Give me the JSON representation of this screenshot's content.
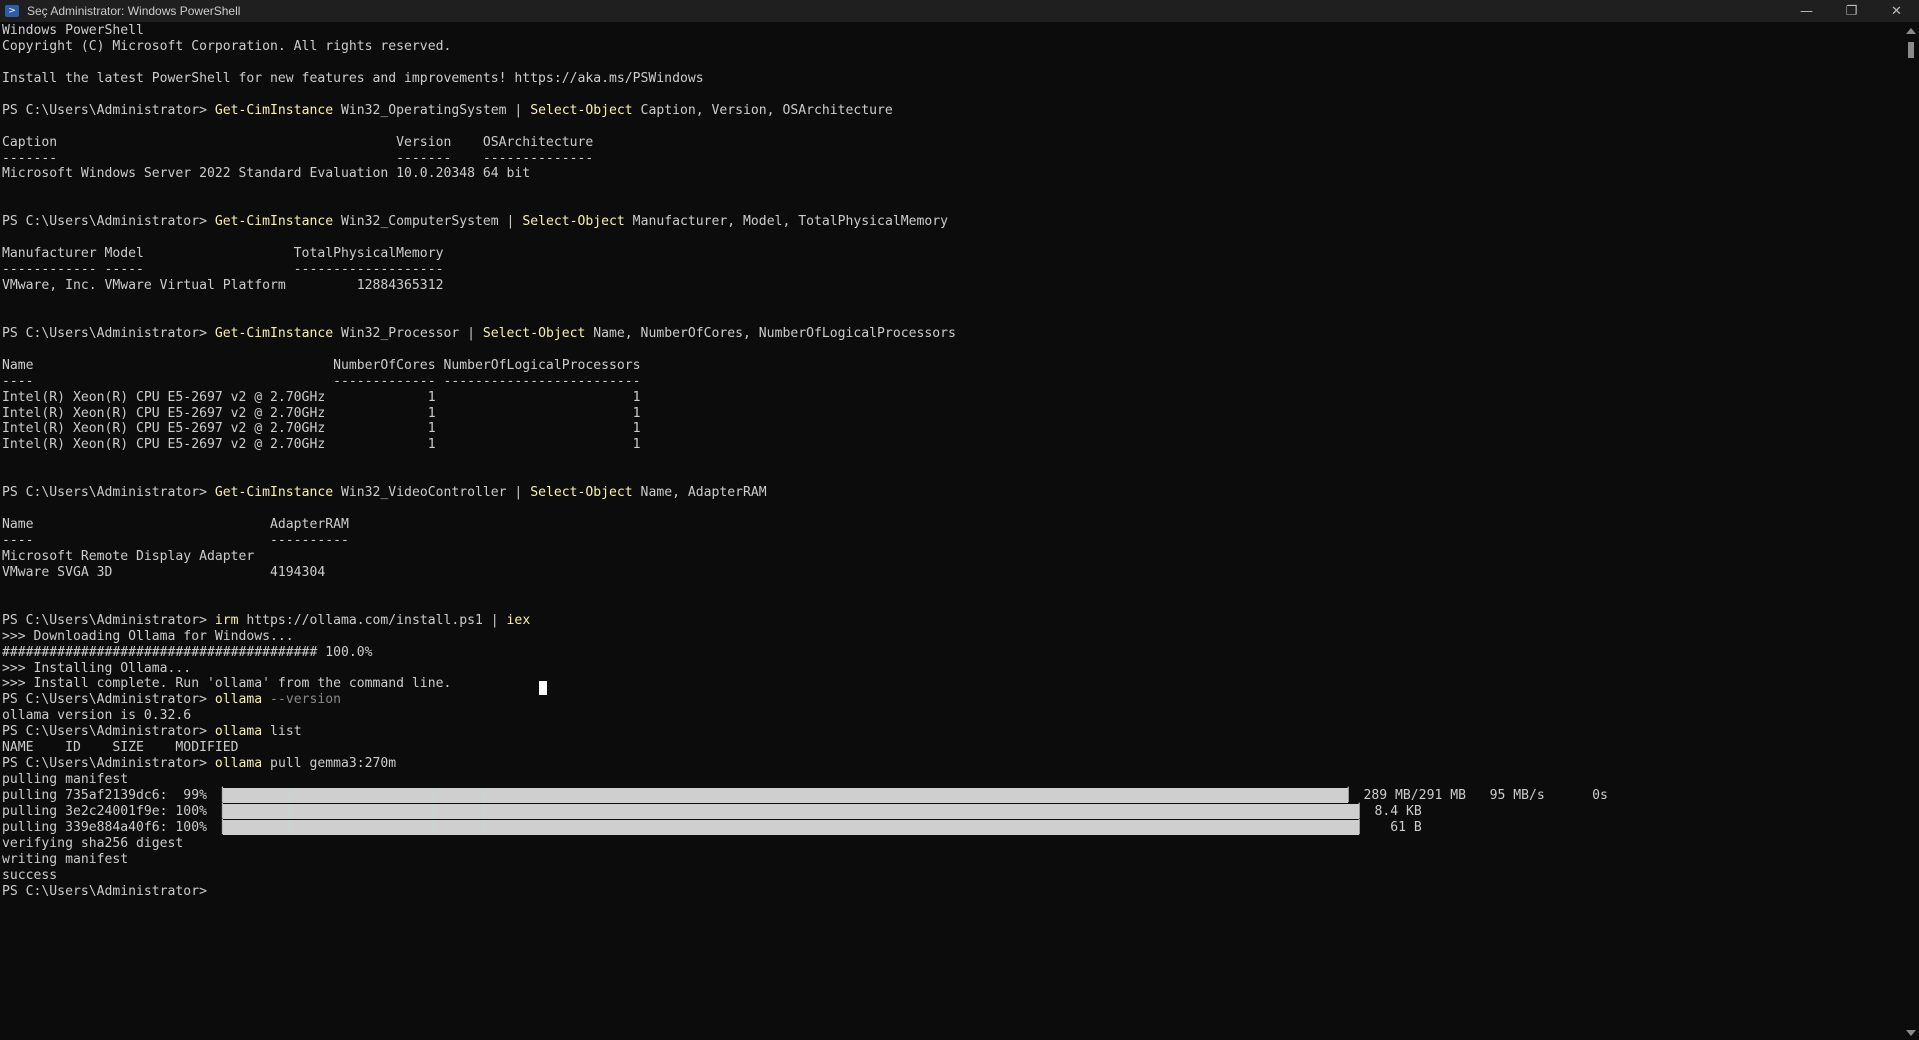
{
  "window": {
    "title": "Seç Administrator: Windows PowerShell",
    "icon": "powershell-icon",
    "controls": {
      "minimize": "—",
      "restore": "❐",
      "close": "✕"
    }
  },
  "console": {
    "prompt": "PS C:\\Users\\Administrator>",
    "lines": [
      [
        {
          "t": "Windows PowerShell"
        }
      ],
      [
        {
          "t": "Copyright (C) Microsoft Corporation. All rights reserved."
        }
      ],
      [
        {
          "t": ""
        }
      ],
      [
        {
          "t": "Install the latest PowerShell for new features and improvements! https://aka.ms/PSWindows"
        }
      ],
      [
        {
          "t": ""
        }
      ],
      [
        {
          "t": "PS C:\\Users\\Administrator> "
        },
        {
          "t": "Get-CimInstance",
          "c": "cmd"
        },
        {
          "t": " Win32_OperatingSystem | "
        },
        {
          "t": "Select-Object",
          "c": "cmd"
        },
        {
          "t": " Caption, Version, OSArchitecture"
        }
      ],
      [
        {
          "t": ""
        }
      ],
      [
        {
          "t": "Caption                                           Version    OSArchitecture"
        }
      ],
      [
        {
          "t": "-------                                           -------    --------------"
        }
      ],
      [
        {
          "t": "Microsoft Windows Server 2022 Standard Evaluation 10.0.20348 64 bit"
        }
      ],
      [
        {
          "t": ""
        }
      ],
      [
        {
          "t": ""
        }
      ],
      [
        {
          "t": "PS C:\\Users\\Administrator> "
        },
        {
          "t": "Get-CimInstance",
          "c": "cmd"
        },
        {
          "t": " Win32_ComputerSystem | "
        },
        {
          "t": "Select-Object",
          "c": "cmd"
        },
        {
          "t": " Manufacturer, Model, TotalPhysicalMemory"
        }
      ],
      [
        {
          "t": ""
        }
      ],
      [
        {
          "t": "Manufacturer Model                   TotalPhysicalMemory"
        }
      ],
      [
        {
          "t": "------------ -----                   -------------------"
        }
      ],
      [
        {
          "t": "VMware, Inc. VMware Virtual Platform         12884365312"
        }
      ],
      [
        {
          "t": ""
        }
      ],
      [
        {
          "t": ""
        }
      ],
      [
        {
          "t": "PS C:\\Users\\Administrator> "
        },
        {
          "t": "Get-CimInstance",
          "c": "cmd"
        },
        {
          "t": " Win32_Processor | "
        },
        {
          "t": "Select-Object",
          "c": "cmd"
        },
        {
          "t": " Name, NumberOfCores, NumberOfLogicalProcessors"
        }
      ],
      [
        {
          "t": ""
        }
      ],
      [
        {
          "t": "Name                                      NumberOfCores NumberOfLogicalProcessors"
        }
      ],
      [
        {
          "t": "----                                      ------------- -------------------------"
        }
      ],
      [
        {
          "t": "Intel(R) Xeon(R) CPU E5-2697 v2 @ 2.70GHz             1                         1"
        }
      ],
      [
        {
          "t": "Intel(R) Xeon(R) CPU E5-2697 v2 @ 2.70GHz             1                         1"
        }
      ],
      [
        {
          "t": "Intel(R) Xeon(R) CPU E5-2697 v2 @ 2.70GHz             1                         1"
        }
      ],
      [
        {
          "t": "Intel(R) Xeon(R) CPU E5-2697 v2 @ 2.70GHz             1                         1"
        }
      ],
      [
        {
          "t": ""
        }
      ],
      [
        {
          "t": ""
        }
      ],
      [
        {
          "t": "PS C:\\Users\\Administrator> "
        },
        {
          "t": "Get-CimInstance",
          "c": "cmd"
        },
        {
          "t": " Win32_VideoController | "
        },
        {
          "t": "Select-Object",
          "c": "cmd"
        },
        {
          "t": " Name, AdapterRAM"
        }
      ],
      [
        {
          "t": ""
        }
      ],
      [
        {
          "t": "Name                              AdapterRAM"
        }
      ],
      [
        {
          "t": "----                              ----------"
        }
      ],
      [
        {
          "t": "Microsoft Remote Display Adapter"
        }
      ],
      [
        {
          "t": "VMware SVGA 3D                    4194304"
        }
      ],
      [
        {
          "t": ""
        }
      ],
      [
        {
          "t": ""
        }
      ],
      [
        {
          "t": "PS C:\\Users\\Administrator> "
        },
        {
          "t": "irm",
          "c": "cmd"
        },
        {
          "t": " https://ollama.com/install.ps1 | "
        },
        {
          "t": "iex",
          "c": "cmd"
        }
      ],
      [
        {
          "t": ">>> Downloading Ollama for Windows..."
        }
      ],
      [
        {
          "t": "######################################## 100.0%"
        }
      ],
      [
        {
          "t": ">>> Installing Ollama..."
        }
      ],
      [
        {
          "t": ">>> Install complete. Run 'ollama' from the command line."
        }
      ],
      [
        {
          "t": "PS C:\\Users\\Administrator> "
        },
        {
          "t": "ollama",
          "c": "cmd"
        },
        {
          "t": " --version",
          "c": "par"
        }
      ],
      [
        {
          "t": "ollama version is 0.32.6"
        }
      ],
      [
        {
          "t": "PS C:\\Users\\Administrator> "
        },
        {
          "t": "ollama",
          "c": "cmd"
        },
        {
          "t": " list"
        }
      ],
      [
        {
          "t": "NAME    ID    SIZE    MODIFIED"
        }
      ],
      [
        {
          "t": "PS C:\\Users\\Administrator> "
        },
        {
          "t": "ollama",
          "c": "cmd"
        },
        {
          "t": " pull gemma3:270m"
        }
      ],
      [
        {
          "t": "pulling manifest"
        }
      ],
      [
        {
          "t": "pulling 735af2139dc6:  99% ▕"
        },
        {
          "bar": 0.99
        },
        {
          "t": "▏ 289 MB/291 MB   95 MB/s      0s"
        }
      ],
      [
        {
          "t": "pulling 3e2c24001f9e: 100% ▕"
        },
        {
          "bar": 1.0
        },
        {
          "t": "▏ 8.4 KB"
        }
      ],
      [
        {
          "t": "pulling 339e884a40f6: 100% ▕"
        },
        {
          "bar": 1.0
        },
        {
          "t": "▏   61 B"
        }
      ],
      [
        {
          "t": "verifying sha256 digest"
        }
      ],
      [
        {
          "t": "writing manifest"
        }
      ],
      [
        {
          "t": "success"
        }
      ],
      [
        {
          "t": "PS C:\\Users\\Administrator>"
        }
      ]
    ]
  }
}
